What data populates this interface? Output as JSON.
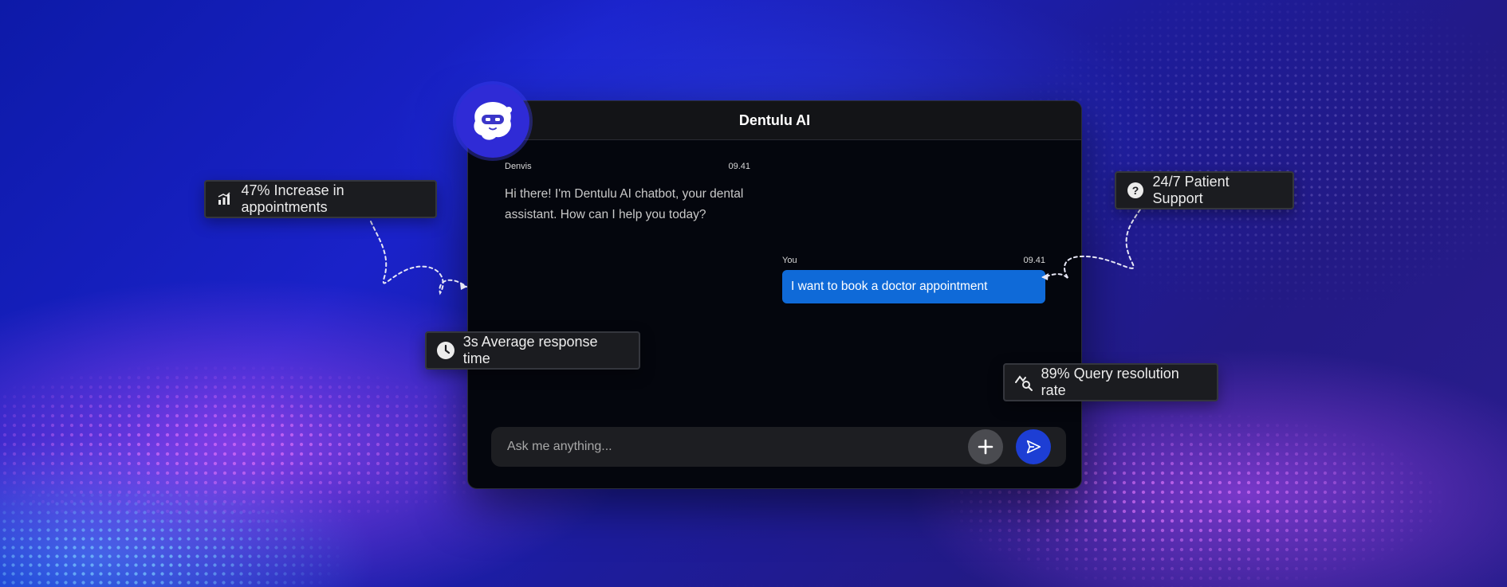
{
  "chat": {
    "title": "Dentulu AI",
    "bot_message": {
      "sender": "Denvis",
      "time": "09.41",
      "text": "Hi there! I'm Dentulu AI chatbot, your dental assistant. How can I help you today?"
    },
    "user_message": {
      "sender": "You",
      "time": "09.41",
      "text": "I want to book a doctor appointment"
    },
    "input": {
      "placeholder": "Ask me anything..."
    },
    "icons": {
      "avatar": "robot-mascot-icon",
      "add": "plus-icon",
      "send": "send-icon"
    }
  },
  "stats": {
    "appointments": {
      "label": "47% Increase in appointments",
      "icon": "bar-chart-icon"
    },
    "response_time": {
      "label": "3s Average response time",
      "icon": "clock-icon"
    },
    "support": {
      "label": "24/7 Patient Support",
      "icon": "question-icon"
    },
    "resolution": {
      "label": "89% Query resolution rate",
      "icon": "chart-search-icon"
    }
  },
  "colors": {
    "user_bubble": "#0f6ad8",
    "send_button": "#1d3ed4",
    "avatar": "#2f2bd6",
    "window_bg": "#04060d"
  }
}
